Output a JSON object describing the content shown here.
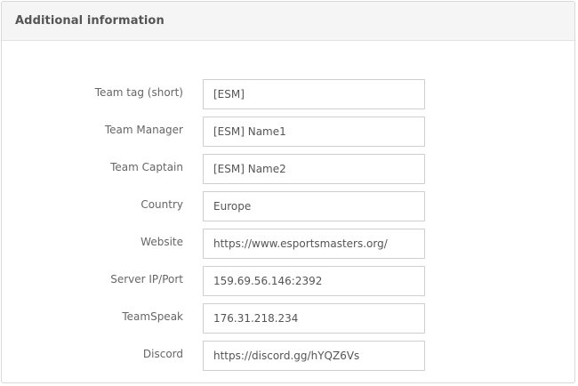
{
  "panel": {
    "title": "Additional information"
  },
  "fields": [
    {
      "label": "Team tag (short)",
      "value": "[ESM]"
    },
    {
      "label": "Team Manager",
      "value": "[ESM] Name1"
    },
    {
      "label": "Team Captain",
      "value": "[ESM] Name2"
    },
    {
      "label": "Country",
      "value": "Europe"
    },
    {
      "label": "Website",
      "value": "https://www.esportsmasters.org/"
    },
    {
      "label": "Server IP/Port",
      "value": "159.69.56.146:2392"
    },
    {
      "label": "TeamSpeak",
      "value": "176.31.218.234"
    },
    {
      "label": "Discord",
      "value": "https://discord.gg/hYQZ6Vs"
    }
  ]
}
